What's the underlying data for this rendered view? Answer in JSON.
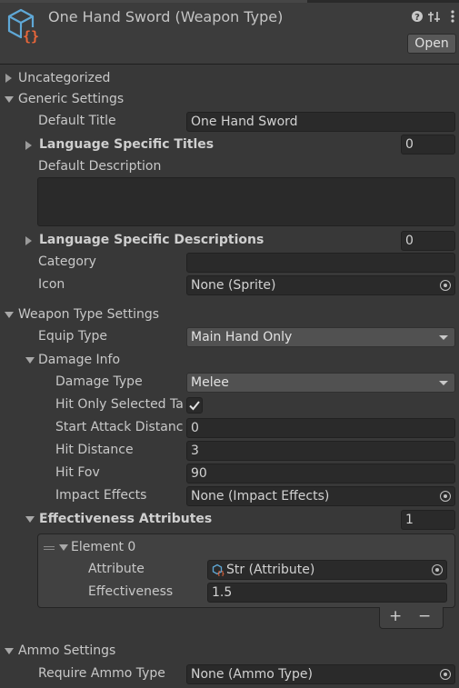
{
  "header": {
    "title": "One Hand Sword (Weapon Type)",
    "open_label": "Open",
    "icons": [
      "scriptable-object-icon",
      "help-icon",
      "preset-icon",
      "kebab-menu-icon"
    ]
  },
  "sections": {
    "uncategorized": "Uncategorized",
    "generic_settings": "Generic Settings",
    "weapon_type_settings": "Weapon Type Settings",
    "damage_info": "Damage Info",
    "ammo_settings": "Ammo Settings"
  },
  "generic": {
    "default_title_label": "Default Title",
    "default_title_value": "One Hand Sword",
    "lang_titles_label": "Language Specific Titles",
    "lang_titles_count": "0",
    "default_description_label": "Default Description",
    "default_description_value": "",
    "lang_desc_label": "Language Specific Descriptions",
    "lang_desc_count": "0",
    "category_label": "Category",
    "category_value": "",
    "icon_label": "Icon",
    "icon_value": "None (Sprite)"
  },
  "weapon": {
    "equip_type_label": "Equip Type",
    "equip_type_value": "Main Hand Only",
    "damage_type_label": "Damage Type",
    "damage_type_value": "Melee",
    "hit_only_selected_label": "Hit Only Selected Ta",
    "hit_only_selected_checked": true,
    "start_attack_distance_label": "Start Attack Distanc",
    "start_attack_distance_value": "0",
    "hit_distance_label": "Hit Distance",
    "hit_distance_value": "3",
    "hit_fov_label": "Hit Fov",
    "hit_fov_value": "90",
    "impact_effects_label": "Impact Effects",
    "impact_effects_value": "None (Impact Effects)",
    "effectiveness_attributes_label": "Effectiveness Attributes",
    "effectiveness_attributes_count": "1",
    "element0_label": "Element 0",
    "attribute_label": "Attribute",
    "attribute_value": "Str (Attribute)",
    "effectiveness_label": "Effectiveness",
    "effectiveness_value": "1.5",
    "add_label": "+",
    "remove_label": "−"
  },
  "ammo": {
    "require_ammo_type_label": "Require Ammo Type",
    "require_ammo_type_value": "None (Ammo Type)"
  },
  "colors": {
    "background": "#383838",
    "header_bg": "#3c3c3c",
    "field_bg": "#2a2a2a",
    "dropdown_bg": "#515151",
    "icon_blue": "#5fa8d6",
    "icon_orange": "#e8663a"
  }
}
